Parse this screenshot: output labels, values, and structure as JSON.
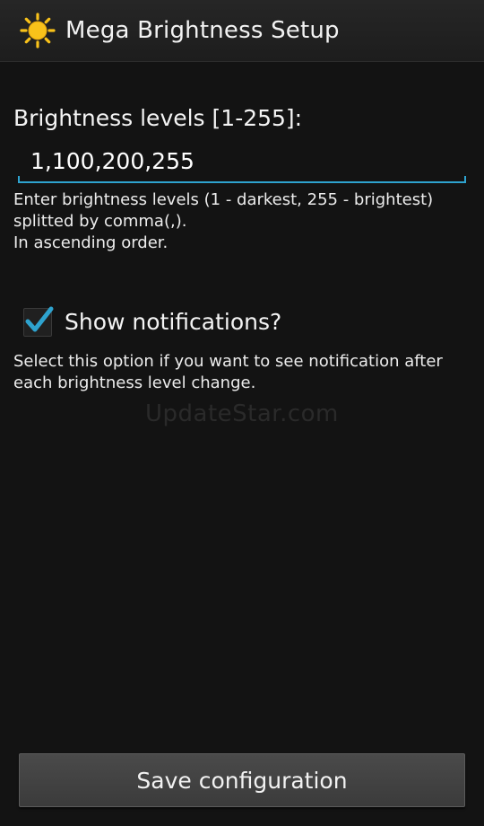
{
  "app_bar": {
    "title": "Mega Brightness Setup",
    "icon": "sun-icon"
  },
  "levels": {
    "label": "Brightness levels [1-255]:",
    "value": "1,100,200,255",
    "help_lines": [
      "Enter brightness levels (1 - darkest, 255 - brightest)",
      "splitted by comma(,).",
      "In ascending order."
    ]
  },
  "notifications": {
    "label": "Show notifications?",
    "checked": true,
    "help_lines": [
      "Select this option if you want to see notification after",
      "each brightness level change."
    ]
  },
  "watermark": "UpdateStar.com",
  "save_button_label": "Save configuration",
  "colors": {
    "accent": "#2ea3cf",
    "sun": "#f9c21a",
    "background": "#131313"
  }
}
